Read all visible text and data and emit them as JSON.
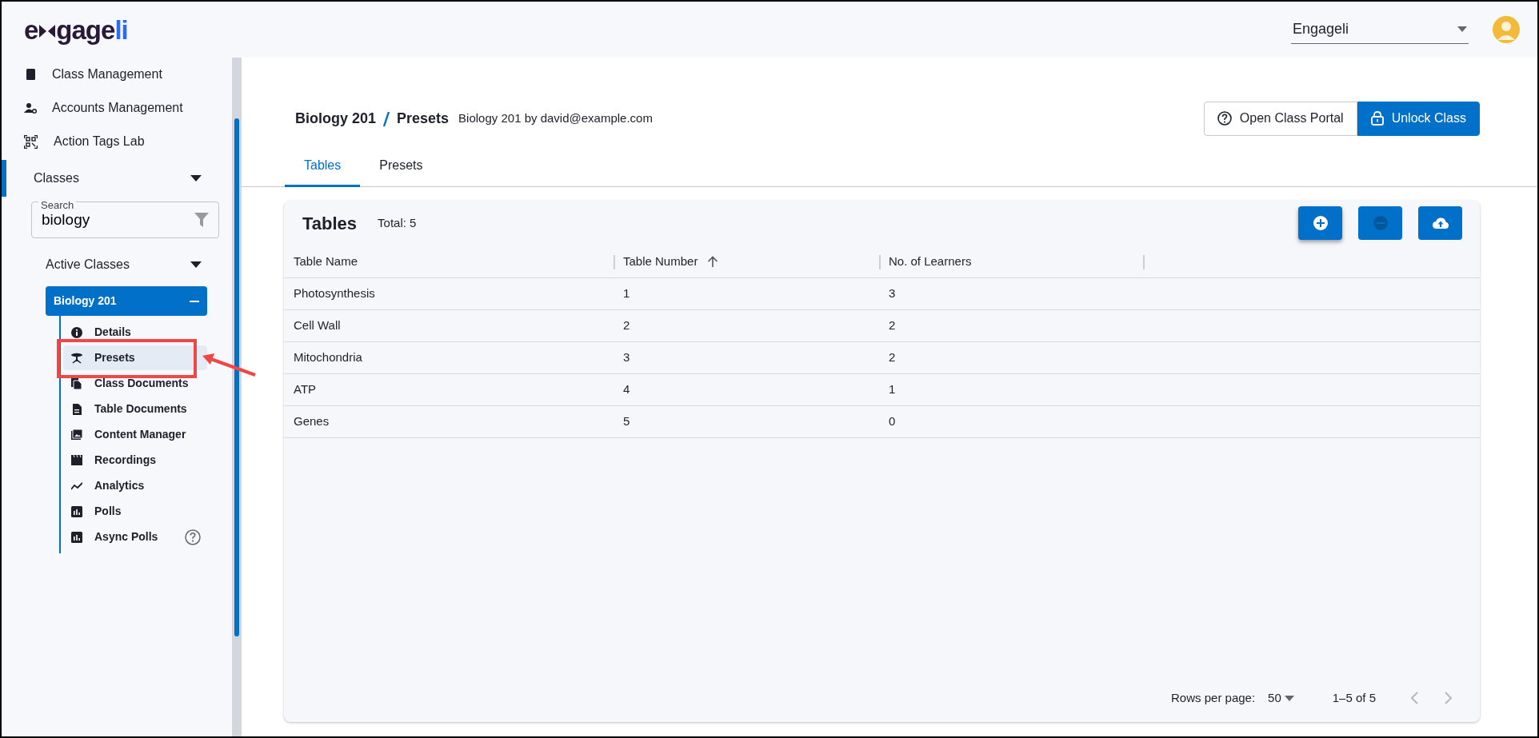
{
  "logo": {
    "lead": "e",
    "middle": "gage",
    "accent": "li"
  },
  "account_select": {
    "value": "Engageli"
  },
  "sidebar": {
    "items": [
      {
        "label": "Class Management"
      },
      {
        "label": "Accounts Management"
      },
      {
        "label": "Action Tags Lab"
      }
    ],
    "classes": {
      "label": "Classes",
      "expanded": true
    },
    "search": {
      "label": "Search",
      "value": "biology"
    },
    "active_classes": {
      "label": "Active Classes",
      "expanded": true
    },
    "class_item": {
      "label": "Biology 201",
      "expanded": true,
      "children": [
        {
          "label": "Details",
          "selected": false,
          "help": false
        },
        {
          "label": "Presets",
          "selected": true,
          "help": false
        },
        {
          "label": "Class Documents",
          "selected": false,
          "help": false
        },
        {
          "label": "Table Documents",
          "selected": false,
          "help": false
        },
        {
          "label": "Content Manager",
          "selected": false,
          "help": false
        },
        {
          "label": "Recordings",
          "selected": false,
          "help": false
        },
        {
          "label": "Analytics",
          "selected": false,
          "help": false
        },
        {
          "label": "Polls",
          "selected": false,
          "help": false
        },
        {
          "label": "Async Polls",
          "selected": false,
          "help": true
        }
      ]
    }
  },
  "header": {
    "breadcrumb": [
      "Biology 201",
      "Presets"
    ],
    "subtitle": "Biology 201 by david@example.com",
    "actions": [
      {
        "label": "Open Class Portal",
        "kind": "outline"
      },
      {
        "label": "Unlock Class",
        "kind": "primary"
      }
    ]
  },
  "tabs": [
    {
      "label": "Tables",
      "selected": true
    },
    {
      "label": "Presets",
      "selected": false
    }
  ],
  "table_card": {
    "title": "Tables",
    "total": "Total: 5",
    "toolbar": [
      {
        "kind": "add",
        "disabled": false
      },
      {
        "kind": "remove",
        "disabled": true
      },
      {
        "kind": "upload",
        "disabled": false
      }
    ],
    "columns": [
      {
        "label": "Table Name",
        "sorted": false
      },
      {
        "label": "Table Number",
        "sorted": true
      },
      {
        "label": "No. of Learners",
        "sorted": false
      }
    ],
    "rows": [
      [
        "Photosynthesis",
        "1",
        "3"
      ],
      [
        "Cell Wall",
        "2",
        "2"
      ],
      [
        "Mitochondria",
        "3",
        "2"
      ],
      [
        "ATP",
        "4",
        "1"
      ],
      [
        "Genes",
        "5",
        "0"
      ]
    ],
    "pagination": {
      "rows_label": "Rows per page:",
      "rows_value": "50",
      "range": "1–5 of 5",
      "prev_disabled": true,
      "next_disabled": true
    }
  }
}
